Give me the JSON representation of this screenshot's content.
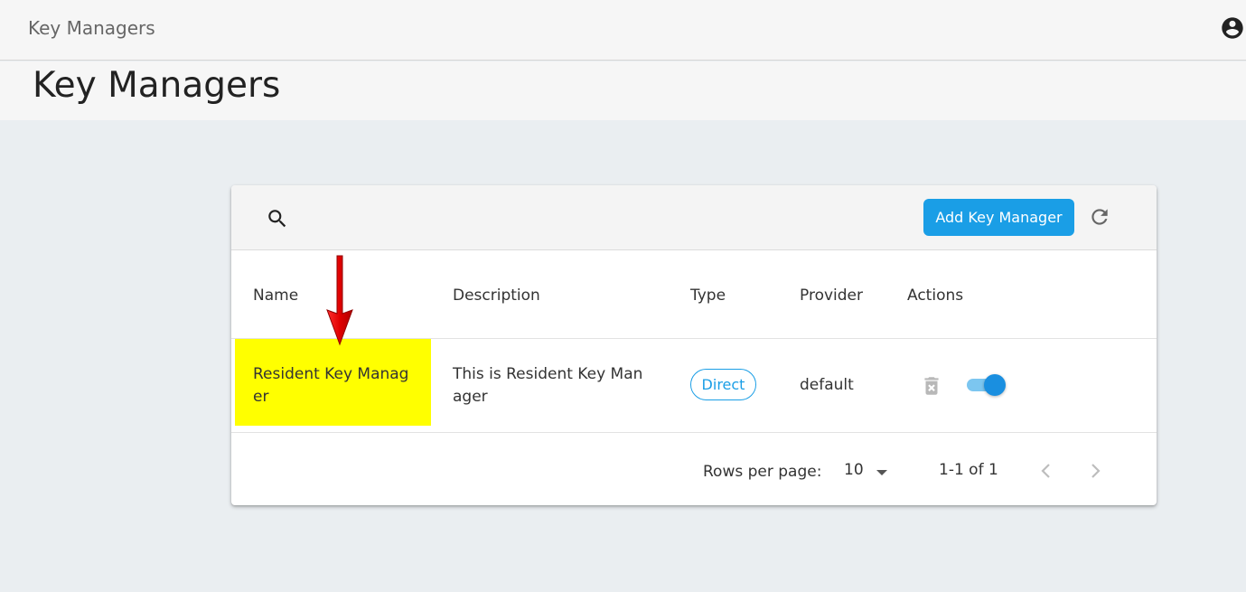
{
  "app": {
    "title": "Key Managers"
  },
  "page": {
    "title": "Key Managers"
  },
  "toolbar": {
    "add_label": "Add Key Manager"
  },
  "table": {
    "headers": [
      "Name",
      "Description",
      "Type",
      "Provider",
      "Actions"
    ],
    "rows": [
      {
        "name": "Resident Key Manag\ner",
        "description": "This is Resident Key Man\nager",
        "type": "Direct",
        "provider": "default",
        "enabled": true
      }
    ]
  },
  "pagination": {
    "rows_per_page_label": "Rows per page:",
    "rows_per_page_value": "10",
    "range": "1-1 of 1"
  },
  "colors": {
    "accent": "#1a9ee6",
    "highlight": "#ffff00",
    "annotation_arrow": "#e60000"
  }
}
